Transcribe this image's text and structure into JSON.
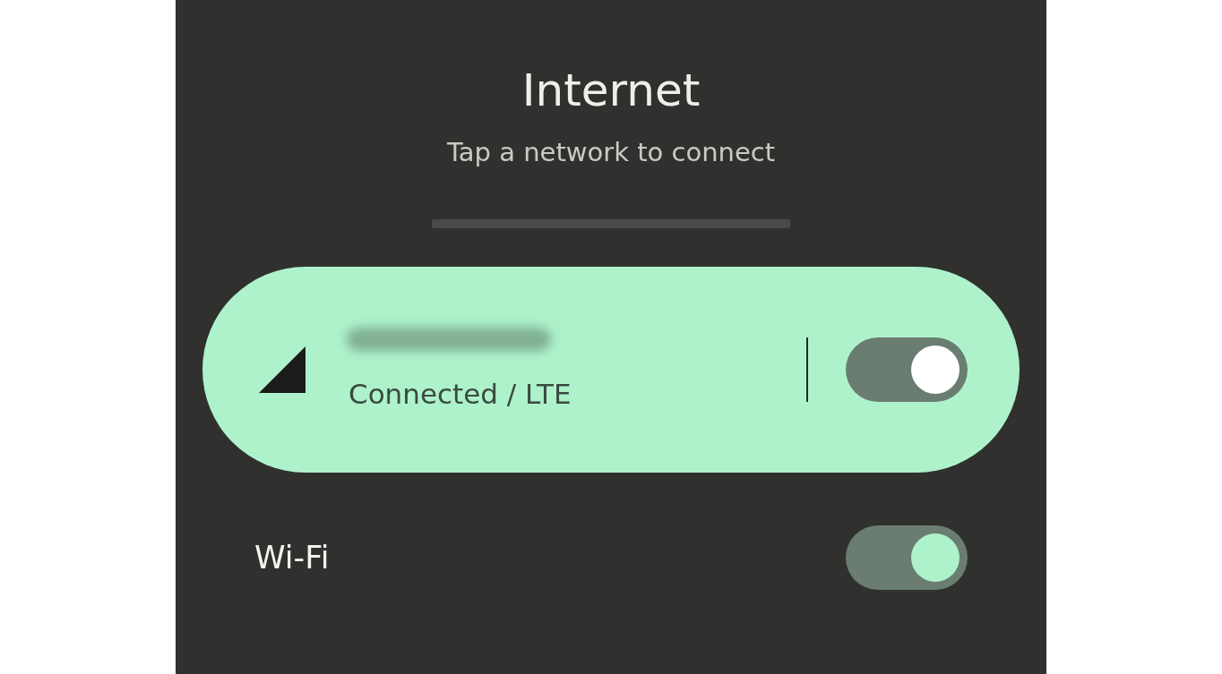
{
  "title": "Internet",
  "subtitle": "Tap a network to connect",
  "mobile_network": {
    "status": "Connected / LTE",
    "on": true,
    "selected": true
  },
  "wifi": {
    "label": "Wi-Fi",
    "on": true
  }
}
